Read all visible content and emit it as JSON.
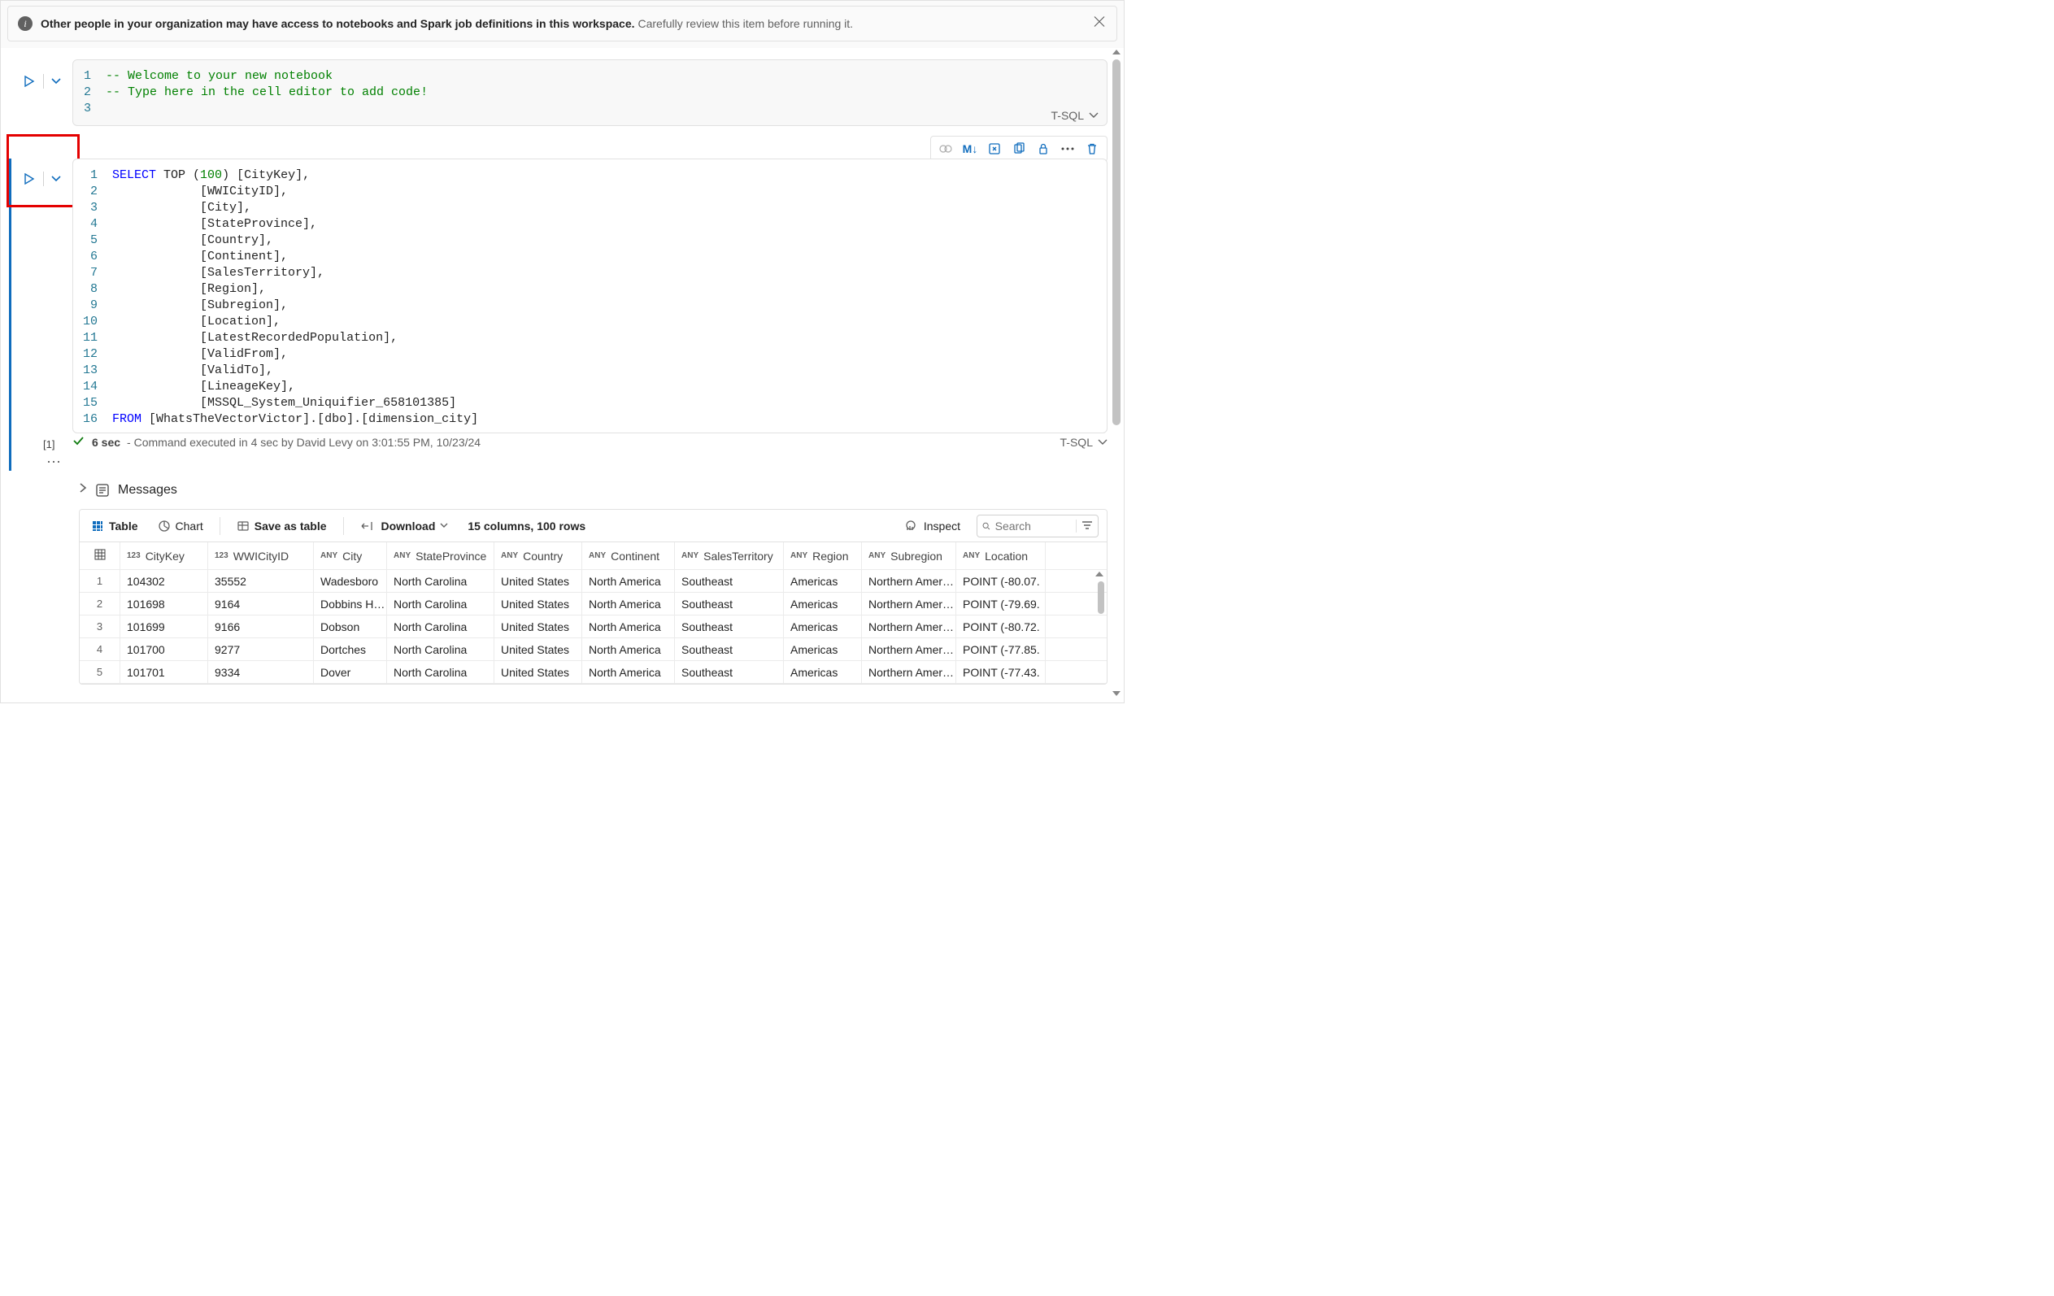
{
  "banner": {
    "bold": "Other people in your organization may have access to notebooks and Spark job definitions in this workspace.",
    "rest": "Carefully review this item before running it."
  },
  "cell1": {
    "lines": [
      "-- Welcome to your new notebook",
      "-- Type here in the cell editor to add code!",
      ""
    ],
    "lang": "T-SQL"
  },
  "cell2": {
    "toolbar_md": "M↓",
    "gutter": [
      "1",
      "2",
      "3",
      "4",
      "5",
      "6",
      "7",
      "8",
      "9",
      "10",
      "11",
      "12",
      "13",
      "14",
      "15",
      "16"
    ],
    "code_tokens": [
      [
        {
          "c": "tok-kw",
          "t": "SELECT"
        },
        {
          "t": " TOP ("
        },
        {
          "c": "tok-num",
          "t": "100"
        },
        {
          "t": ") [CityKey],"
        }
      ],
      [
        {
          "t": "            [WWICityID],"
        }
      ],
      [
        {
          "t": "            [City],"
        }
      ],
      [
        {
          "t": "            [StateProvince],"
        }
      ],
      [
        {
          "t": "            [Country],"
        }
      ],
      [
        {
          "t": "            [Continent],"
        }
      ],
      [
        {
          "t": "            [SalesTerritory],"
        }
      ],
      [
        {
          "t": "            [Region],"
        }
      ],
      [
        {
          "t": "            [Subregion],"
        }
      ],
      [
        {
          "t": "            [Location],"
        }
      ],
      [
        {
          "t": "            [LatestRecordedPopulation],"
        }
      ],
      [
        {
          "t": "            [ValidFrom],"
        }
      ],
      [
        {
          "t": "            [ValidTo],"
        }
      ],
      [
        {
          "t": "            [LineageKey],"
        }
      ],
      [
        {
          "t": "            [MSSQL_System_Uniquifier_658101385]"
        }
      ],
      [
        {
          "c": "tok-kw",
          "t": "FROM"
        },
        {
          "t": " [WhatsTheVectorVictor].[dbo].[dimension_city]"
        }
      ]
    ],
    "exec_count": "[1]",
    "status_time": "6 sec",
    "status_text": "- Command executed in 4 sec by David Levy on 3:01:55 PM, 10/23/24",
    "lang": "T-SQL"
  },
  "messages": {
    "title": "Messages"
  },
  "results": {
    "toolbar": {
      "table": "Table",
      "chart": "Chart",
      "save": "Save as table",
      "download": "Download",
      "summary": "15 columns, 100 rows",
      "inspect": "Inspect",
      "search_placeholder": "Search"
    },
    "columns": [
      {
        "type": "123",
        "name": "CityKey",
        "cls": "col0"
      },
      {
        "type": "123",
        "name": "WWICityID",
        "cls": "col1"
      },
      {
        "type": "ANY",
        "name": "City",
        "cls": "col2"
      },
      {
        "type": "ANY",
        "name": "StateProvince",
        "cls": "col3"
      },
      {
        "type": "ANY",
        "name": "Country",
        "cls": "col4"
      },
      {
        "type": "ANY",
        "name": "Continent",
        "cls": "col5"
      },
      {
        "type": "ANY",
        "name": "SalesTerritory",
        "cls": "col6"
      },
      {
        "type": "ANY",
        "name": "Region",
        "cls": "col7"
      },
      {
        "type": "ANY",
        "name": "Subregion",
        "cls": "col8"
      },
      {
        "type": "ANY",
        "name": "Location",
        "cls": "col9"
      }
    ],
    "rows": [
      {
        "n": "1",
        "v": [
          "104302",
          "35552",
          "Wadesboro",
          "North Carolina",
          "United States",
          "North America",
          "Southeast",
          "Americas",
          "Northern Amer…",
          "POINT (-80.07."
        ]
      },
      {
        "n": "2",
        "v": [
          "101698",
          "9164",
          "Dobbins H…",
          "North Carolina",
          "United States",
          "North America",
          "Southeast",
          "Americas",
          "Northern Amer…",
          "POINT (-79.69."
        ]
      },
      {
        "n": "3",
        "v": [
          "101699",
          "9166",
          "Dobson",
          "North Carolina",
          "United States",
          "North America",
          "Southeast",
          "Americas",
          "Northern Amer…",
          "POINT (-80.72."
        ]
      },
      {
        "n": "4",
        "v": [
          "101700",
          "9277",
          "Dortches",
          "North Carolina",
          "United States",
          "North America",
          "Southeast",
          "Americas",
          "Northern Amer…",
          "POINT (-77.85."
        ]
      },
      {
        "n": "5",
        "v": [
          "101701",
          "9334",
          "Dover",
          "North Carolina",
          "United States",
          "North America",
          "Southeast",
          "Americas",
          "Northern Amer…",
          "POINT (-77.43."
        ]
      }
    ]
  }
}
